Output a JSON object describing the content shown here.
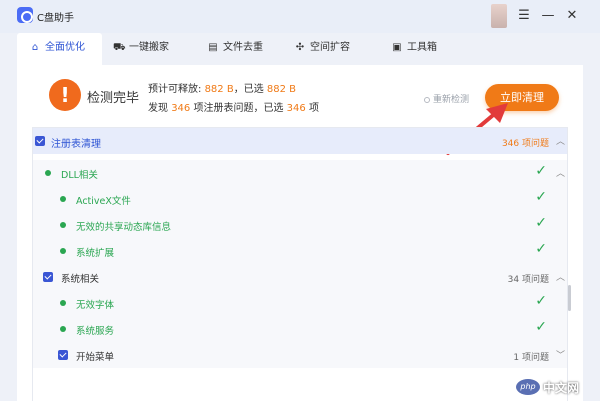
{
  "app": {
    "title": "C盘助手",
    "logo_icon": "app-logo-icon"
  },
  "window_controls": {
    "menu": "☰",
    "minimize": "—",
    "close": "✕"
  },
  "tabs": [
    {
      "label": "全面优化",
      "icon": "home-icon",
      "glyph": "⌂",
      "active": true
    },
    {
      "label": "一键搬家",
      "icon": "truck-icon",
      "glyph": "⛟",
      "active": false
    },
    {
      "label": "文件去重",
      "icon": "file-icon",
      "glyph": "▤",
      "active": false
    },
    {
      "label": "空间扩容",
      "icon": "expand-icon",
      "glyph": "✣",
      "active": false
    },
    {
      "label": "工具箱",
      "icon": "toolbox-icon",
      "glyph": "▣",
      "active": false
    }
  ],
  "summary": {
    "status_title": "检测完毕",
    "warn_glyph": "!",
    "line1_prefix": "预计可释放:",
    "line1_value1": "882 B",
    "line1_mid": "，已选",
    "line1_value2": "882 B",
    "line2_prefix": "发现",
    "line2_value1": "346",
    "line2_mid": "项注册表问题，已选",
    "line2_value2": "346",
    "line2_suffix": "项",
    "rescan_label": "重新检测",
    "clean_button_label": "立即清理"
  },
  "list": {
    "header": {
      "label": "注册表清理",
      "count": "346 项问题",
      "chevron": "︿"
    },
    "dll_group": {
      "label": "DLL相关",
      "check": "✓",
      "chevron": "︿"
    },
    "dll_items": [
      {
        "label": "ActiveX文件",
        "check": "✓"
      },
      {
        "label": "无效的共享动态库信息",
        "check": "✓"
      },
      {
        "label": "系统扩展",
        "check": "✓"
      }
    ],
    "system_group": {
      "label": "系统相关",
      "count": "34 项问题",
      "chevron": "︿"
    },
    "system_items": [
      {
        "label": "无效字体",
        "check": "✓"
      },
      {
        "label": "系统服务",
        "check": "✓"
      }
    ],
    "start_menu": {
      "label": "开始菜单",
      "count": "1 项问题",
      "chevron": "﹀"
    }
  },
  "watermark": {
    "logo": "php",
    "text": "中文网"
  },
  "colors": {
    "accent": "#2f55d4",
    "orange": "#f07a17",
    "green": "#2aa651",
    "arrow_red": "#e23b3b"
  }
}
